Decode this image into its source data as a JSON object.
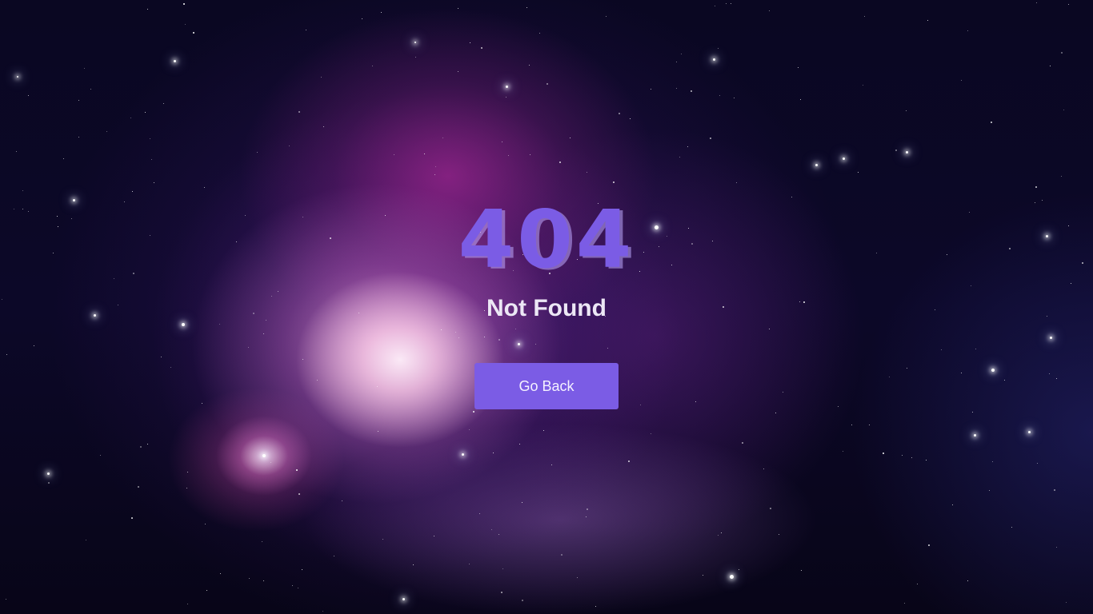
{
  "error": {
    "code": "404",
    "title": "Not Found"
  },
  "actions": {
    "go_back_label": "Go Back"
  },
  "colors": {
    "accent": "#7b5ce5",
    "title_text": "#ece7f5",
    "button_text": "#f4f1ff",
    "background": "#0a0620"
  }
}
